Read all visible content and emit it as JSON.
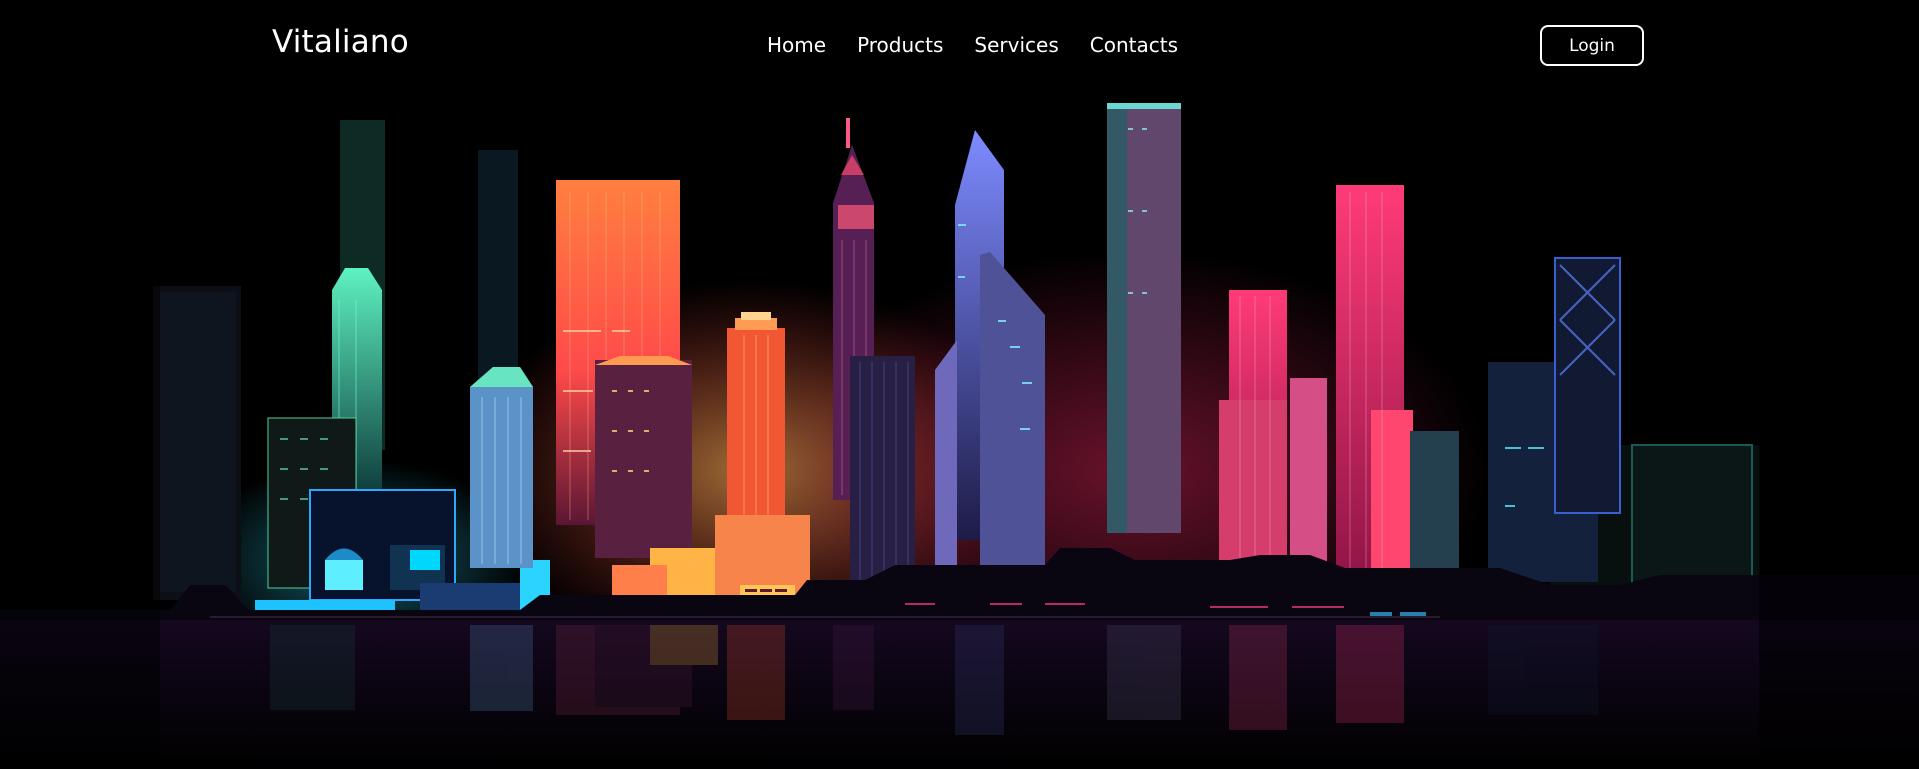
{
  "header": {
    "brand": "Vitaliano",
    "nav": [
      "Home",
      "Products",
      "Services",
      "Contacts"
    ],
    "login_label": "Login"
  },
  "theme": {
    "background": "#000000",
    "text": "#ffffff",
    "accent_pink": "#ff2f6e",
    "accent_orange": "#ff8a3d",
    "accent_cyan": "#27d3ff",
    "accent_teal": "#5cf2c8",
    "accent_purple": "#7a46ff"
  },
  "hero": {
    "image": "neon-city-skyline-illustration"
  }
}
